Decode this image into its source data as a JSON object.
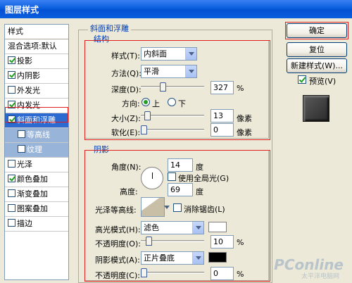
{
  "window": {
    "title": "图层样式"
  },
  "stylelist": {
    "header": "样式",
    "blend": "混合选项:默认",
    "items": [
      {
        "label": "投影",
        "checked": true
      },
      {
        "label": "内阴影",
        "checked": true
      },
      {
        "label": "外发光",
        "checked": false
      },
      {
        "label": "内发光",
        "checked": true
      },
      {
        "label": "斜面和浮雕",
        "checked": true
      },
      {
        "label": "等高线",
        "checked": false
      },
      {
        "label": "纹理",
        "checked": false
      },
      {
        "label": "光泽",
        "checked": false
      },
      {
        "label": "颜色叠加",
        "checked": true
      },
      {
        "label": "渐变叠加",
        "checked": false
      },
      {
        "label": "图案叠加",
        "checked": false
      },
      {
        "label": "描边",
        "checked": false
      }
    ]
  },
  "bevel": {
    "section": "斜面和浮雕",
    "structure": "结构",
    "style_label": "样式(T):",
    "style_value": "内斜面",
    "technique_label": "方法(Q):",
    "technique_value": "平滑",
    "depth_label": "深度(D):",
    "depth_value": "327",
    "depth_unit": "%",
    "direction_label": "方向:",
    "dir_up": "上",
    "dir_down": "下",
    "size_label": "大小(Z):",
    "size_value": "13",
    "size_unit": "像素",
    "soften_label": "软化(E):",
    "soften_value": "0",
    "soften_unit": "像素"
  },
  "shading": {
    "section": "阴影",
    "angle_label": "角度(N):",
    "angle_value": "14",
    "angle_unit": "度",
    "global_light": "使用全局光(G)",
    "altitude_label": "高度:",
    "altitude_value": "69",
    "altitude_unit": "度",
    "gloss_label": "光泽等高线:",
    "antialias": "消除锯齿(L)",
    "highlight_label": "高光模式(H):",
    "highlight_value": "滤色",
    "highlight_color": "#ffffff",
    "hl_opacity_label": "不透明度(O):",
    "hl_opacity_value": "10",
    "hl_opacity_unit": "%",
    "shadow_label": "阴影模式(A):",
    "shadow_value": "正片叠底",
    "shadow_color": "#000000",
    "sh_opacity_label": "不透明度(C):",
    "sh_opacity_value": "0",
    "sh_opacity_unit": "%"
  },
  "buttons": {
    "ok": "确定",
    "reset": "复位",
    "new_style": "新建样式(W)...",
    "preview": "预览(V)"
  },
  "watermark": {
    "brand": "PConline",
    "sub": "太平洋电脑网"
  }
}
